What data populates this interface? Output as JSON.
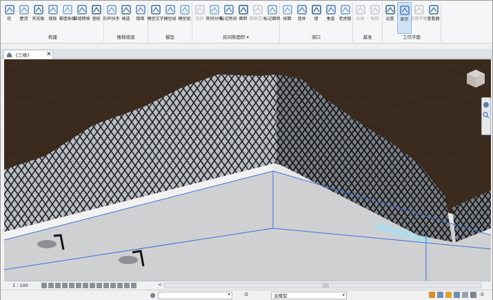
{
  "ribbon": {
    "groups": [
      {
        "label": "构建",
        "buttons": [
          {
            "label": "柱",
            "icon": "column-icon"
          },
          {
            "label": "屋顶",
            "icon": "roof-icon"
          },
          {
            "label": "天花板",
            "icon": "ceiling-icon"
          },
          {
            "label": "楼板",
            "icon": "floor-icon"
          },
          {
            "label": "幕墙系统",
            "icon": "curtain-system-icon"
          },
          {
            "label": "幕墙网格",
            "icon": "curtain-grid-icon"
          },
          {
            "label": "竖梃",
            "icon": "mullion-icon"
          }
        ]
      },
      {
        "label": "楼梯坡道",
        "buttons": [
          {
            "label": "栏杆扶手",
            "icon": "railing-icon"
          },
          {
            "label": "坡道",
            "icon": "ramp-icon"
          },
          {
            "label": "楼梯",
            "icon": "stair-icon"
          }
        ]
      },
      {
        "label": "模型",
        "buttons": [
          {
            "label": "模型文字",
            "icon": "model-text-icon"
          },
          {
            "label": "模型线",
            "icon": "model-line-icon"
          },
          {
            "label": "模型组",
            "icon": "model-group-icon"
          }
        ]
      },
      {
        "label": "房间和面积 ▾",
        "buttons": [
          {
            "label": "房间",
            "icon": "room-icon",
            "dim": true
          },
          {
            "label": "房间分隔",
            "icon": "room-separator-icon"
          },
          {
            "label": "标记房间",
            "icon": "tag-room-icon"
          },
          {
            "label": "面积",
            "icon": "area-icon"
          },
          {
            "label": "面积边界",
            "icon": "area-boundary-icon",
            "dim": true
          },
          {
            "label": "标记面积",
            "icon": "tag-area-icon"
          }
        ]
      },
      {
        "label": "洞口",
        "buttons": [
          {
            "label": "按面",
            "icon": "by-face-icon"
          },
          {
            "label": "竖井",
            "icon": "shaft-icon"
          },
          {
            "label": "墙",
            "icon": "wall-opening-icon"
          },
          {
            "label": "垂直",
            "icon": "vertical-opening-icon"
          },
          {
            "label": "老虎窗",
            "icon": "dormer-icon"
          }
        ]
      },
      {
        "label": "基准",
        "buttons": [
          {
            "label": "标高",
            "icon": "level-icon",
            "dim": true
          },
          {
            "label": "轴网",
            "icon": "grid-icon",
            "dim": true
          }
        ]
      },
      {
        "label": "工作平面",
        "buttons": [
          {
            "label": "设置",
            "icon": "set-workplane-icon"
          },
          {
            "label": "显示",
            "icon": "show-workplane-icon",
            "active": true
          },
          {
            "label": "参照平面",
            "icon": "ref-plane-icon",
            "dim": true
          },
          {
            "label": "查看器",
            "icon": "viewer-icon"
          }
        ]
      }
    ]
  },
  "view_tab": {
    "title": "{三维}",
    "close": "✕"
  },
  "view_bar": {
    "scale": "1 : 100",
    "arrow": "<"
  },
  "status_bar": {
    "zero": ":0",
    "model": "主模型"
  },
  "colors": {
    "terrain": "#3b2b1f",
    "wall": "#e9e9e9",
    "floor": "#cfd0d2",
    "glass": "#b7bcc4",
    "mullion": "#2a2a2a",
    "edge_blue": "#3d6ed8"
  }
}
